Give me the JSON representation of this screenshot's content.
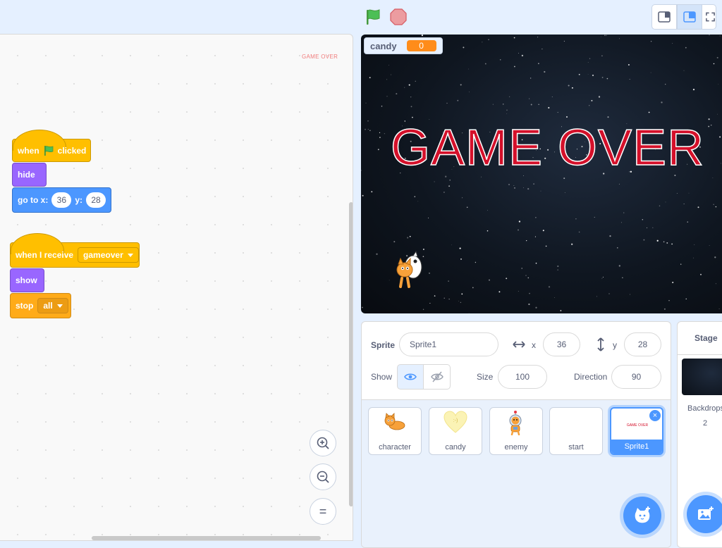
{
  "code_area": {
    "sprite_watermark": "GAME OVER",
    "script1": {
      "hat_when": "when",
      "hat_clicked": "clicked",
      "hide_label": "hide",
      "goto_label": "go to x:",
      "goto_x": "36",
      "goto_y_label": "y:",
      "goto_y": "28"
    },
    "script2": {
      "hat_label": "when I receive",
      "message": "gameover",
      "show_label": "show",
      "stop_label": "stop",
      "stop_option": "all"
    },
    "zoom": {
      "reset_label": "="
    }
  },
  "stage": {
    "variable_name": "candy",
    "variable_value": "0",
    "game_over_text": "GAME OVER"
  },
  "sprite_info": {
    "sprite_label": "Sprite",
    "sprite_name": "Sprite1",
    "x_label": "x",
    "x_value": "36",
    "y_label": "y",
    "y_value": "28",
    "show_label": "Show",
    "size_label": "Size",
    "size_value": "100",
    "direction_label": "Direction",
    "direction_value": "90"
  },
  "sprites": [
    {
      "name": "character",
      "icon": "cat-icon"
    },
    {
      "name": "candy",
      "icon": "heart-candy-icon"
    },
    {
      "name": "enemy",
      "icon": "space-cat-icon"
    },
    {
      "name": "start",
      "icon": ""
    },
    {
      "name": "Sprite1",
      "icon": "game-over-thumb",
      "selected": true,
      "thumb_text": "GAME OVER"
    }
  ],
  "stage_pane": {
    "title": "Stage",
    "backdrops_label": "Backdrops",
    "backdrops_count": "2"
  },
  "colors": {
    "accent": "#4c97ff",
    "events": "#ffbf00",
    "looks": "#9966ff",
    "motion": "#4c97ff",
    "control": "#ffab19",
    "game_over_red": "#d4102a",
    "variable_orange": "#ff8c1a"
  }
}
